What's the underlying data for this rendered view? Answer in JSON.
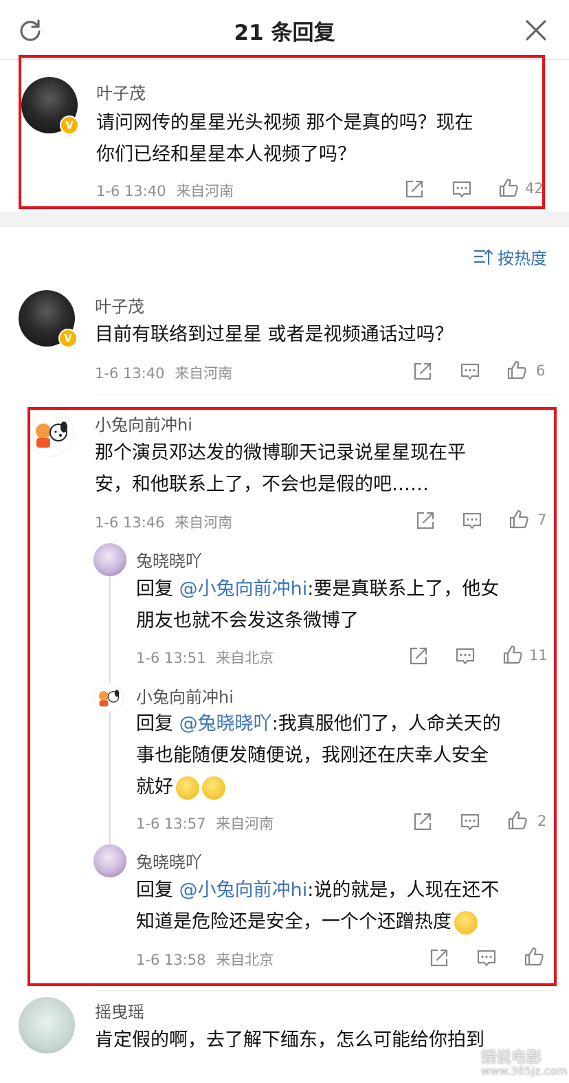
{
  "header": {
    "title": "21 条回复"
  },
  "sort": {
    "label": "按热度"
  },
  "root": {
    "username": "叶子茂",
    "text_lines": [
      "请问网传的星星光头视频 那个是真的吗？现在",
      "你们已经和星星本人视频了吗？"
    ],
    "time": "1-6 13:40",
    "location": "来自河南",
    "likes": "42"
  },
  "comments": [
    {
      "username": "叶子茂",
      "text_lines": [
        "目前有联络到过星星 或者是视频通话过吗？"
      ],
      "time": "1-6 13:40",
      "location": "来自河南",
      "likes": "6"
    },
    {
      "username": "小兔向前冲hi",
      "text_lines": [
        "那个演员邓达发的微博聊天记录说星星现在平",
        "安，和他联系上了，不会也是假的吧……"
      ],
      "time": "1-6 13:46",
      "location": "来自河南",
      "likes": "7"
    }
  ],
  "replies": [
    {
      "username": "兔晓晓吖",
      "reply_prefix": "回复 ",
      "mention": "@小兔向前冲hi",
      "line1_rest": ":要是真联系上了，他女",
      "line2": "朋友也就不会发这条微博了",
      "time": "1-6 13:51",
      "location": "来自北京",
      "likes": "11"
    },
    {
      "username": "小兔向前冲hi",
      "reply_prefix": "回复 ",
      "mention": "@兔晓晓吖",
      "line1_rest": ":我真服他们了，人命关天的",
      "line2": "事也能随便发随便说，我刚还在庆幸人安全",
      "line3": "就好",
      "time": "1-6 13:57",
      "location": "来自河南",
      "likes": "2"
    },
    {
      "username": "兔晓晓吖",
      "reply_prefix": "回复 ",
      "mention": "@小兔向前冲hi",
      "line1_rest": ":说的就是，人现在还不",
      "line2": "知道是危险还是安全，一个个还蹭热度",
      "time": "1-6 13:58",
      "location": "来自北京",
      "likes": ""
    }
  ],
  "last": {
    "username": "摇曳瑶",
    "text_lines": [
      "肯定假的啊，去了解下缅东，怎么可能给你拍到"
    ]
  },
  "watermark": {
    "line1": "娱说电影",
    "line2": "www.365jz.com"
  },
  "colors": {
    "accent": "#3b73b7",
    "highlight_box": "#e5121b",
    "verified_badge": "#f6b400"
  }
}
